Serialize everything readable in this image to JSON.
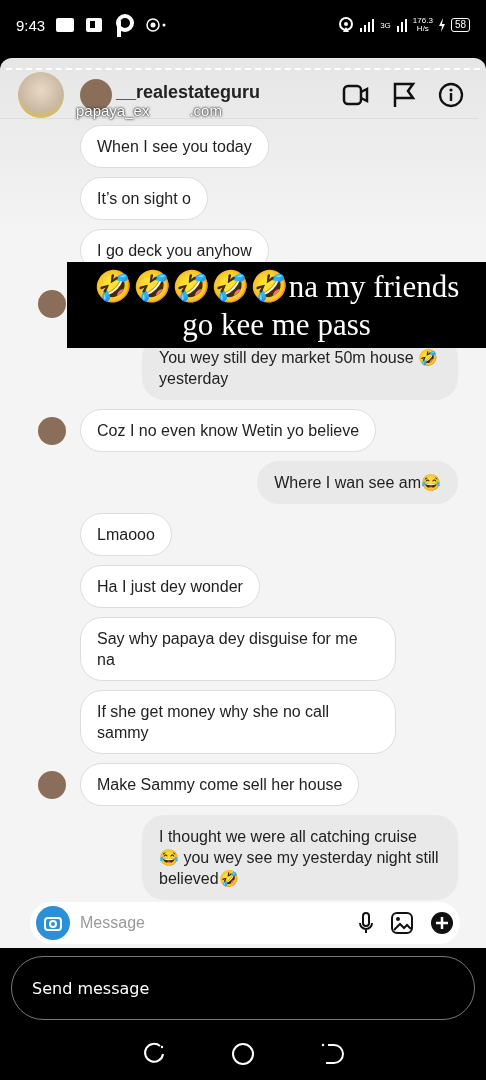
{
  "status_bar": {
    "time": "9:43",
    "network": "3G",
    "speed": "176.3",
    "speed_unit": "H/s",
    "battery": "58"
  },
  "story": {
    "poster_name": "papaya_ex",
    "overlay_suffix": ".com",
    "chat": {
      "username": "__realestateguru",
      "messages": [
        {
          "kind": "received",
          "avatar": false,
          "text": "When I see you today"
        },
        {
          "kind": "received",
          "avatar": false,
          "text": "It’s on sight o"
        },
        {
          "kind": "received",
          "avatar": false,
          "text": "I go deck you anyhow"
        },
        {
          "kind": "avatar"
        },
        {
          "kind": "sent",
          "text": "You wey still dey market 50m house 🤣 yesterday"
        },
        {
          "kind": "received",
          "avatar": true,
          "text": "Coz I no even know Wetin yo believe"
        },
        {
          "kind": "sent",
          "text": "Where I wan see am😂"
        },
        {
          "kind": "received",
          "avatar": false,
          "text": "Lmaooo"
        },
        {
          "kind": "received",
          "avatar": false,
          "text": "Ha I just dey wonder"
        },
        {
          "kind": "received",
          "avatar": false,
          "text": "Say why papaya dey disguise for me na"
        },
        {
          "kind": "received",
          "avatar": false,
          "text": "If she get money why she no call sammy"
        },
        {
          "kind": "received",
          "avatar": true,
          "text": "Make Sammy come sell her house"
        },
        {
          "kind": "sent",
          "text": "I thought we were all catching cruise 😂 you wey see my yesterday night still believed🤣"
        }
      ],
      "composer": {
        "placeholder": "Message"
      }
    },
    "caption": "🤣🤣🤣🤣🤣na my friends go kee me pass"
  },
  "reply": {
    "placeholder": "Send message"
  }
}
